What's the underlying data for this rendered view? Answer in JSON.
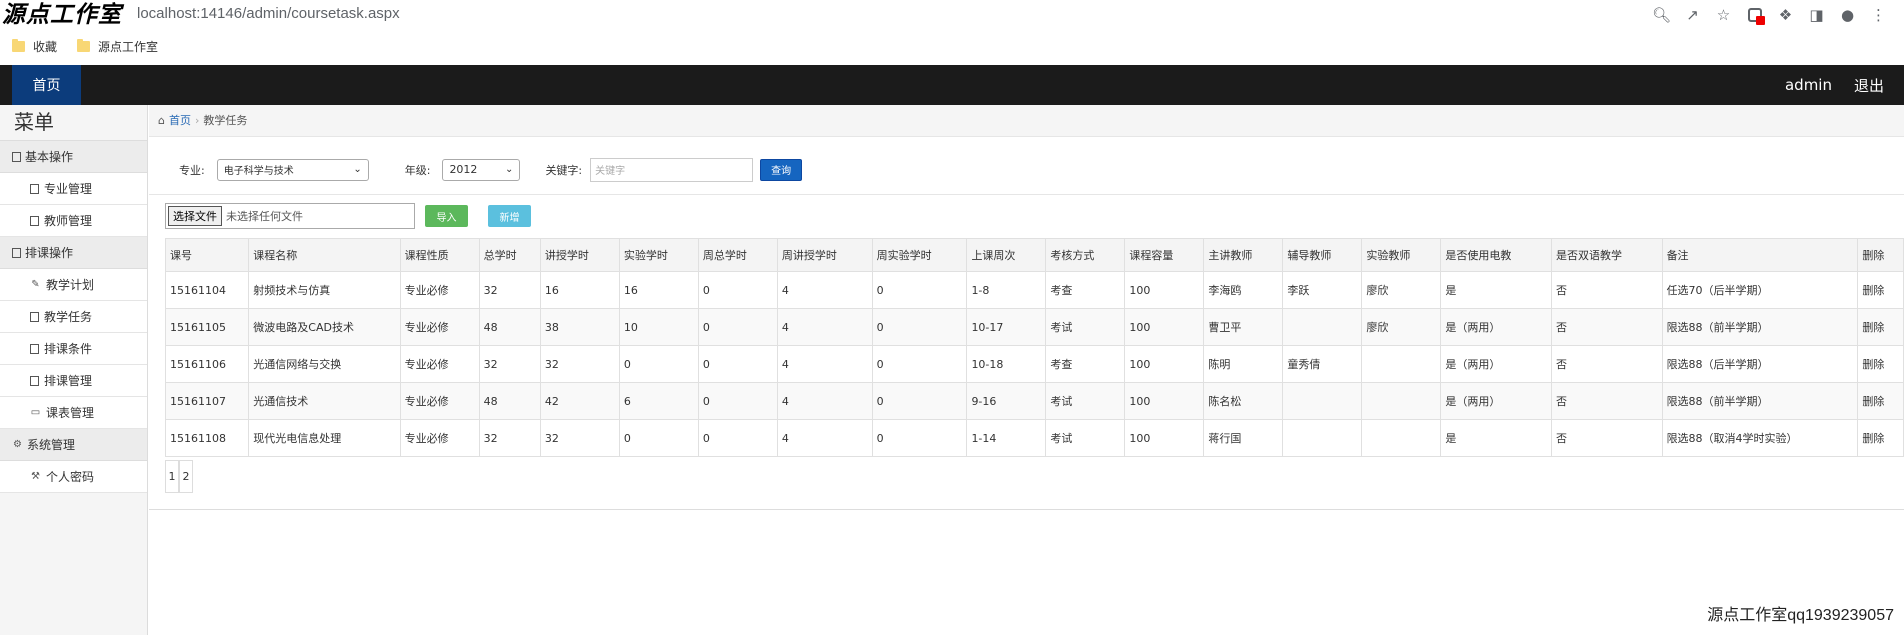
{
  "browser": {
    "logo_text": "源点工作室",
    "url": "localhost:14146/admin/coursetask.aspx",
    "bookmarks": [
      "收藏",
      "源点工作室"
    ]
  },
  "header": {
    "home": "首页",
    "user": "admin",
    "logout": "退出"
  },
  "sidebar": {
    "title": "菜单",
    "groups": [
      {
        "label": "基本操作",
        "items": [
          "专业管理",
          "教师管理"
        ]
      },
      {
        "label": "排课操作",
        "items": [
          "教学计划",
          "教学任务",
          "排课条件",
          "排课管理",
          "课表管理"
        ]
      },
      {
        "label": "系统管理",
        "items": [
          "个人密码"
        ]
      }
    ]
  },
  "breadcrumb": {
    "home": "首页",
    "sep": "›",
    "current": "教学任务"
  },
  "filters": {
    "major_label": "专业:",
    "major_value": "电子科学与技术",
    "grade_label": "年级:",
    "grade_value": "2012",
    "keyword_label": "关键字:",
    "keyword_placeholder": "关键字",
    "query_button": "查询"
  },
  "upload": {
    "choose_button": "选择文件",
    "no_file": "未选择任何文件",
    "import_button": "导入",
    "add_button": "新增"
  },
  "table": {
    "headers": [
      "课号",
      "课程名称",
      "课程性质",
      "总学时",
      "讲授学时",
      "实验学时",
      "周总学时",
      "周讲授学时",
      "周实验学时",
      "上课周次",
      "考核方式",
      "课程容量",
      "主讲教师",
      "辅导教师",
      "实验教师",
      "是否使用电教",
      "是否双语教学",
      "备注",
      "删除"
    ],
    "rows": [
      [
        "15161104",
        "射频技术与仿真",
        "专业必修",
        "32",
        "16",
        "16",
        "0",
        "4",
        "0",
        "1-8",
        "考查",
        "100",
        "李海鸥",
        "李跃",
        "廖欣",
        "是",
        "否",
        "任选70（后半学期）",
        "删除"
      ],
      [
        "15161105",
        "微波电路及CAD技术",
        "专业必修",
        "48",
        "38",
        "10",
        "0",
        "4",
        "0",
        "10-17",
        "考试",
        "100",
        "曹卫平",
        "",
        "廖欣",
        "是（两用）",
        "否",
        "限选88（前半学期）",
        "删除"
      ],
      [
        "15161106",
        "光通信网络与交换",
        "专业必修",
        "32",
        "32",
        "0",
        "0",
        "4",
        "0",
        "10-18",
        "考查",
        "100",
        "陈明",
        "童秀倩",
        "",
        "是（两用）",
        "否",
        "限选88（后半学期）",
        "删除"
      ],
      [
        "15161107",
        "光通信技术",
        "专业必修",
        "48",
        "42",
        "6",
        "0",
        "4",
        "0",
        "9-16",
        "考试",
        "100",
        "陈名松",
        "",
        "",
        "是（两用）",
        "否",
        "限选88（前半学期）",
        "删除"
      ],
      [
        "15161108",
        "现代光电信息处理",
        "专业必修",
        "32",
        "32",
        "0",
        "0",
        "4",
        "0",
        "1-14",
        "考试",
        "100",
        "蒋行国",
        "",
        "",
        "是",
        "否",
        "限选88（取消4学时实验）",
        "删除"
      ]
    ]
  },
  "pager": [
    "1",
    "2"
  ],
  "watermark": "源点工作室qq1939239057"
}
